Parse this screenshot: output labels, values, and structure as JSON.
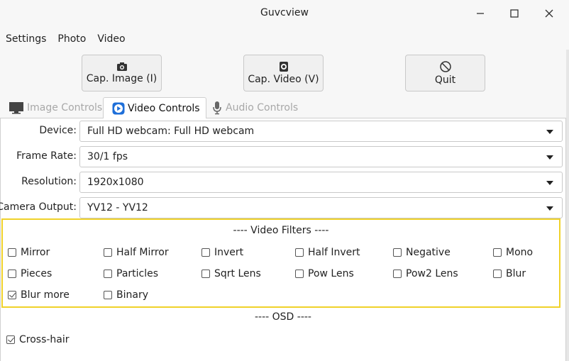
{
  "window": {
    "title": "Guvcview",
    "controls": [
      "minimize-icon",
      "maximize-icon",
      "close-icon"
    ]
  },
  "menu": [
    "Settings",
    "Photo",
    "Video"
  ],
  "toolbar": {
    "cap_image": "Cap. Image (I)",
    "cap_video": "Cap. Video (V)",
    "quit": "Quit"
  },
  "tabs": [
    {
      "label": "Image Controls",
      "icon": "monitor-icon",
      "state": "disabled"
    },
    {
      "label": "Video Controls",
      "icon": "video-play-icon",
      "state": "active"
    },
    {
      "label": "Audio Controls",
      "icon": "microphone-icon",
      "state": "disabled"
    }
  ],
  "video_controls": {
    "device": {
      "label": "Device:",
      "value": "Full HD webcam: Full HD webcam"
    },
    "frame_rate": {
      "label": "Frame Rate:",
      "value": "30/1 fps"
    },
    "resolution": {
      "label": "Resolution:",
      "value": "1920x1080"
    },
    "camera_output": {
      "label": "Camera Output:",
      "value": "YV12 - YV12"
    }
  },
  "video_filters": {
    "title": "---- Video Filters ----",
    "items": [
      {
        "label": "Mirror",
        "checked": false
      },
      {
        "label": "Half Mirror",
        "checked": false
      },
      {
        "label": "Invert",
        "checked": false
      },
      {
        "label": "Half Invert",
        "checked": false
      },
      {
        "label": "Negative",
        "checked": false
      },
      {
        "label": "Mono",
        "checked": false
      },
      {
        "label": "Pieces",
        "checked": false
      },
      {
        "label": "Particles",
        "checked": false
      },
      {
        "label": "Sqrt Lens",
        "checked": false
      },
      {
        "label": "Pow Lens",
        "checked": false
      },
      {
        "label": "Pow2 Lens",
        "checked": false
      },
      {
        "label": "Blur",
        "checked": false
      },
      {
        "label": "Blur more",
        "checked": true
      },
      {
        "label": "Binary",
        "checked": false
      }
    ]
  },
  "osd": {
    "title": "---- OSD ----",
    "items": [
      {
        "label": "Cross-hair",
        "checked": true
      }
    ]
  },
  "colors": {
    "highlight_border": "#f0d22a",
    "active_tab_icon": "#1e6fd9"
  }
}
